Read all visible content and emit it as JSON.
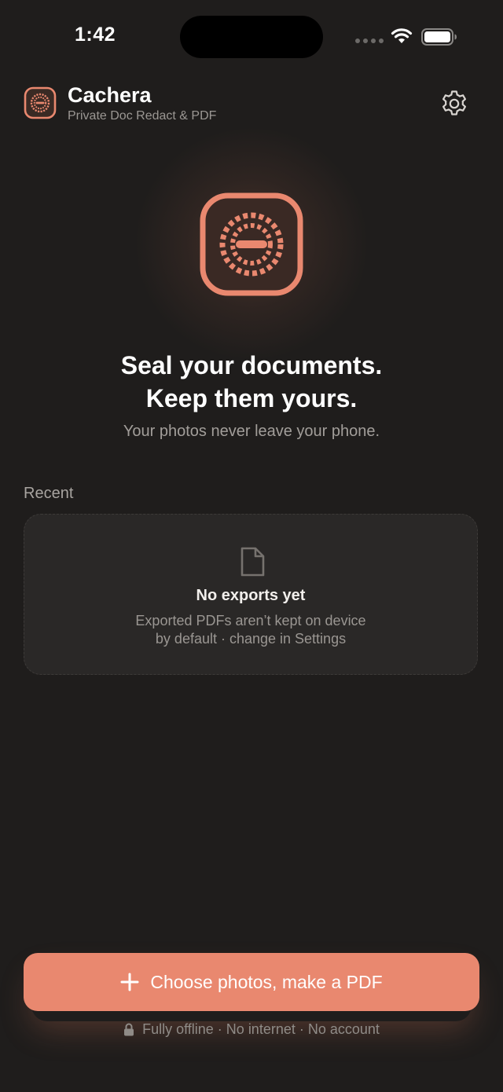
{
  "status_bar": {
    "time": "1:42"
  },
  "header": {
    "app_name": "Cachera",
    "subtitle": "Private Doc Redact & PDF",
    "settings_icon": "gear-icon"
  },
  "hero": {
    "headline_line1": "Seal your documents.",
    "headline_line2": "Keep them yours.",
    "tagline": "Your photos never leave your phone."
  },
  "recent": {
    "label": "Recent",
    "empty_icon": "document-icon",
    "empty_title": "No exports yet",
    "empty_desc_line1": "Exported PDFs aren’t kept on device",
    "empty_desc_line2": "by default · change in Settings"
  },
  "cta": {
    "icon": "plus-icon",
    "label": "Choose photos, make a PDF"
  },
  "footer": {
    "icon": "lock-icon",
    "text": "Fully offline · No internet · No account"
  },
  "colors": {
    "background": "#1f1d1c",
    "accent": "#e9886f",
    "card": "#2a2827"
  }
}
